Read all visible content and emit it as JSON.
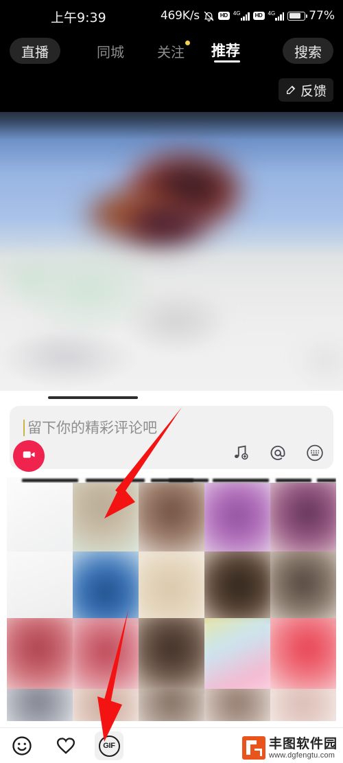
{
  "status_bar": {
    "time": "上午9:39",
    "net_speed": "469K/s",
    "mute_icon": "bell-muted-icon",
    "hd_badge_1": "HD",
    "network_1": "4G",
    "hd_badge_2": "HD",
    "network_2": "4G",
    "battery_icon": "battery-icon",
    "battery_pct": "77%"
  },
  "top_nav": {
    "live_label": "直播",
    "tabs": [
      {
        "label": "同城",
        "active": false,
        "badge": false
      },
      {
        "label": "关注",
        "active": false,
        "badge": true
      },
      {
        "label": "推荐",
        "active": true,
        "badge": false
      }
    ],
    "search_label": "搜索"
  },
  "feedback": {
    "label": "反馈",
    "icon": "pencil-icon"
  },
  "comment_sheet": {
    "drag_handle": "drag-handle",
    "input_placeholder": "留下你的精彩评论吧",
    "input_value": "",
    "video_button_icon": "video-camera-icon",
    "video_button_color": "#f0234f",
    "action_icons": [
      {
        "name": "music-add-icon",
        "glyph": "♬"
      },
      {
        "name": "mention-at-icon",
        "glyph": "@"
      },
      {
        "name": "keyboard-icon",
        "glyph": "⌨"
      }
    ]
  },
  "gif_panel": {
    "state": "open",
    "content_description": "blurred-gif-results-grid"
  },
  "bottom_bar": {
    "items": [
      {
        "name": "emoji-icon",
        "label": "",
        "selected": false
      },
      {
        "name": "heart-icon",
        "label": "",
        "selected": false
      },
      {
        "name": "gif-icon",
        "label": "GIF",
        "selected": true
      }
    ]
  },
  "watermark": {
    "brand_cn": "丰图软件园",
    "url": "www.dgfengtu.com",
    "logo_color": "#e8541c"
  },
  "annotations": {
    "arrow_color": "#f31313",
    "arrow_1_target": "gif-panel-grid",
    "arrow_2_target": "gif-icon"
  }
}
